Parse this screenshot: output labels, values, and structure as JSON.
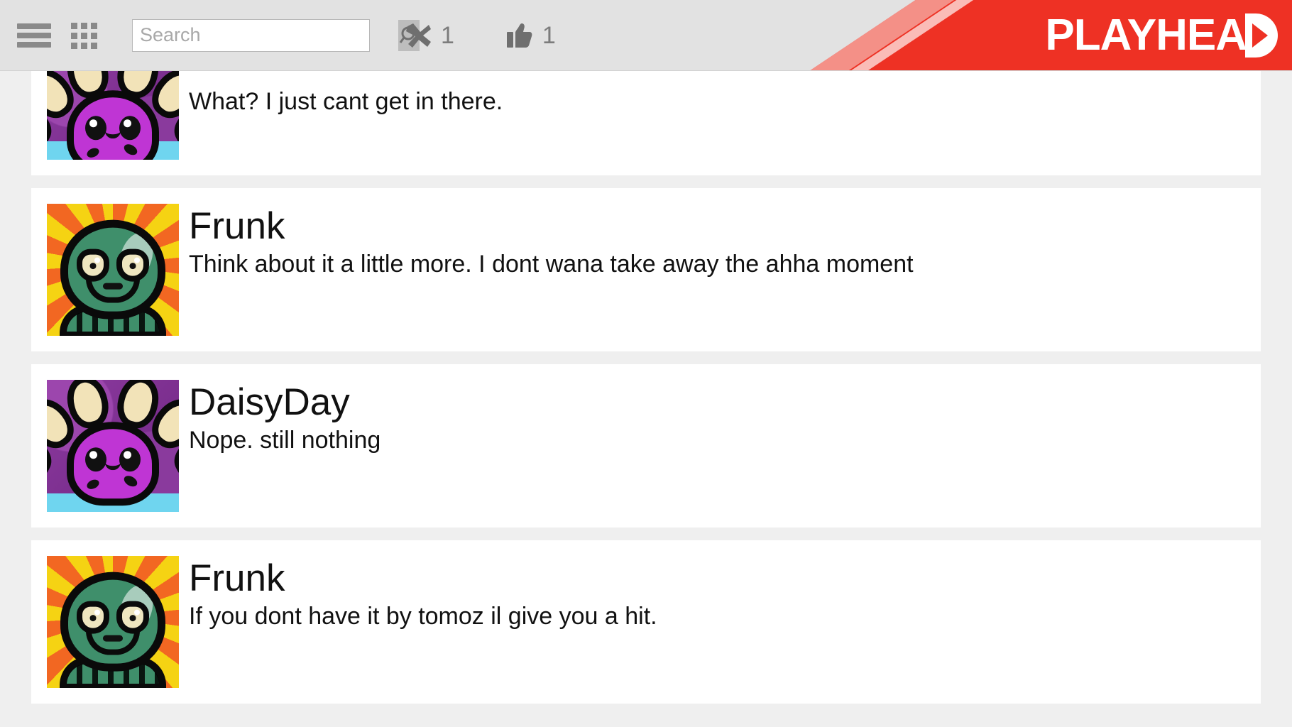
{
  "topbar": {
    "menu_icon": "hamburger-menu-icon",
    "apps_icon": "grid-apps-icon",
    "search": {
      "placeholder": "Search",
      "value": "",
      "button_icon": "search-magnifier-icon"
    },
    "stats": [
      {
        "icon": "crossed-x-icon",
        "count": "1"
      },
      {
        "icon": "thumbs-up-icon",
        "count": "1"
      }
    ],
    "logo": {
      "text": "PLAYHEA",
      "accent_color": "#ee3124",
      "play_marker": "play-triangle"
    }
  },
  "feed": {
    "posts": [
      {
        "avatar": "daisy",
        "username": "",
        "message": "What? I just cant get in there."
      },
      {
        "avatar": "frunk",
        "username": "Frunk",
        "message": "Think about it a little more. I dont wana take away the ahha moment"
      },
      {
        "avatar": "daisy",
        "username": "DaisyDay",
        "message": "Nope. still nothing"
      },
      {
        "avatar": "frunk",
        "username": "Frunk",
        "message": "If you dont have it by tomoz il give you a hit."
      }
    ]
  }
}
